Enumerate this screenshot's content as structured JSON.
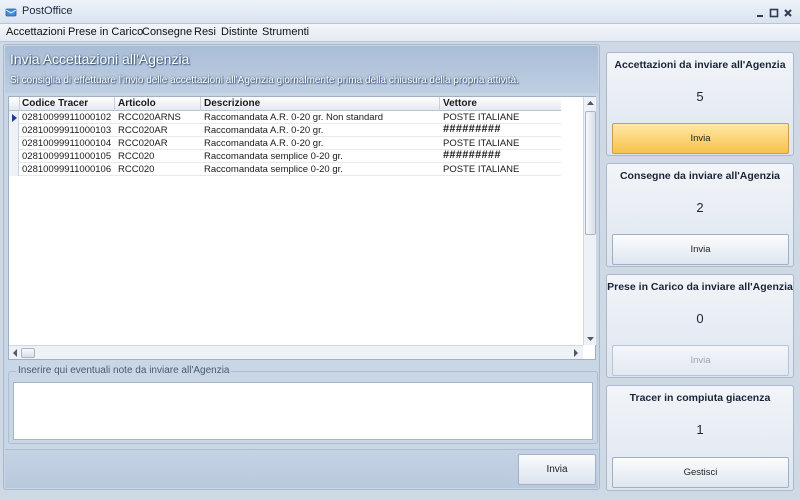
{
  "window": {
    "title": "PostOffice"
  },
  "menu": [
    "Accettazioni",
    "Prese in Carico",
    "Consegne",
    "Resi",
    "Distinte",
    "Strumenti"
  ],
  "main": {
    "title": "Invia Accettazioni all'Agenzia",
    "subtitle": "Si consiglia di effettuare l'invio delle accettazioni all'Agenzia giornalmente  prima della chiusura della propria attività.",
    "columns": [
      "Codice Tracer",
      "Articolo",
      "Descrizione",
      "Vettore"
    ],
    "rows": [
      {
        "tracer": "02810099911000102",
        "articolo": "RCC020ARNS",
        "descrizione": "Raccomandata A.R. 0-20 gr. Non standard",
        "vettore": "POSTE ITALIANE"
      },
      {
        "tracer": "02810099911000103",
        "articolo": "RCC020AR",
        "descrizione": "Raccomandata A.R. 0-20 gr.",
        "vettore": "#########"
      },
      {
        "tracer": "02810099911000104",
        "articolo": "RCC020AR",
        "descrizione": "Raccomandata A.R. 0-20 gr.",
        "vettore": "POSTE ITALIANE"
      },
      {
        "tracer": "02810099911000105",
        "articolo": "RCC020",
        "descrizione": "Raccomandata semplice 0-20 gr.",
        "vettore": "#########"
      },
      {
        "tracer": "02810099911000106",
        "articolo": "RCC020",
        "descrizione": "Raccomandata semplice 0-20 gr.",
        "vettore": "POSTE ITALIANE"
      }
    ],
    "notes_label": "Inserire qui eventuali note da inviare all'Agenzia",
    "notes_value": "",
    "send_label": "Invia"
  },
  "cards": [
    {
      "title": "Accettazioni da inviare all'Agenzia",
      "count": "5",
      "button": "Invia",
      "state": "active"
    },
    {
      "title": "Consegne da inviare all'Agenzia",
      "count": "2",
      "button": "Invia",
      "state": "normal"
    },
    {
      "title": "Prese in Carico da inviare all'Agenzia",
      "count": "0",
      "button": "Invia",
      "state": "disabled"
    },
    {
      "title": "Tracer in compiuta giacenza",
      "count": "1",
      "button": "Gestisci",
      "state": "normal"
    }
  ],
  "colors": {
    "accent_button": "#f6c24a",
    "panel": "#c9d6e6"
  },
  "icons": [
    "app-icon",
    "minimize-icon",
    "maximize-icon",
    "close-icon",
    "row-pointer-icon",
    "scroll-up-icon",
    "scroll-down-icon",
    "scroll-left-icon",
    "scroll-right-icon"
  ]
}
